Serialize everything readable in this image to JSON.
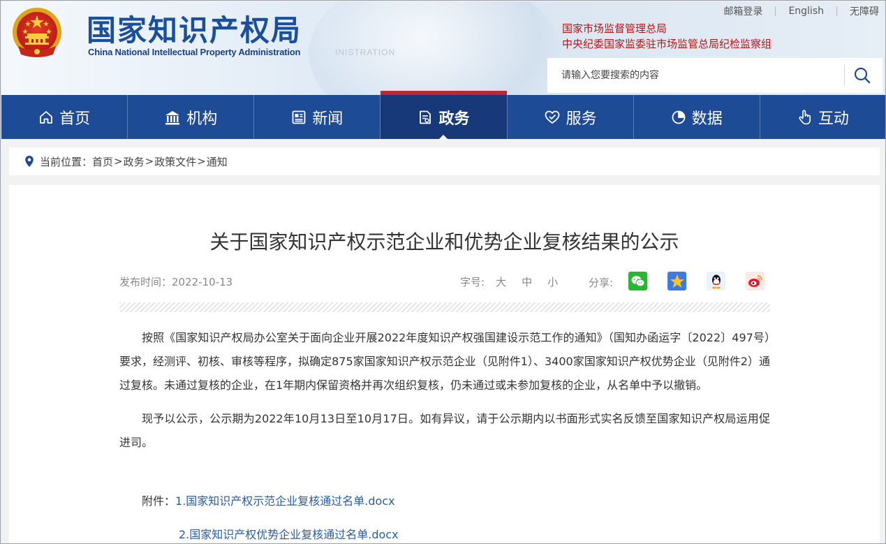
{
  "header": {
    "site_title": "国家知识产权局",
    "site_subtitle": "China National Intellectual Property Administration",
    "top_links": [
      "邮箱登录",
      "English",
      "无障碍"
    ],
    "org_links": [
      "国家市场监督管理总局",
      "中央纪委国家监委驻市场监管总局纪检监察组"
    ],
    "search_placeholder": "请输入您要搜索的内容"
  },
  "nav": {
    "items": [
      {
        "label": "首页",
        "icon": "home-icon"
      },
      {
        "label": "机构",
        "icon": "institution-icon"
      },
      {
        "label": "新闻",
        "icon": "news-icon"
      },
      {
        "label": "政务",
        "icon": "government-affairs-icon",
        "active": true
      },
      {
        "label": "服务",
        "icon": "service-icon"
      },
      {
        "label": "数据",
        "icon": "data-icon"
      },
      {
        "label": "互动",
        "icon": "interaction-icon"
      }
    ]
  },
  "breadcrumb": {
    "prefix": "当前位置：",
    "items": [
      "首页",
      "政务",
      "政策文件",
      "通知"
    ],
    "separator": ">"
  },
  "article": {
    "title": "关于国家知识产权示范企业和优势企业复核结果的公示",
    "publish_label": "发布时间：",
    "publish_date": "2022-10-13",
    "font_size_label": "字号:",
    "font_sizes": [
      "大",
      "中",
      "小"
    ],
    "share_label": "分享:",
    "share_targets": [
      "wechat-icon",
      "qzone-icon",
      "qq-icon",
      "weibo-icon"
    ],
    "paragraphs": [
      "按照《国家知识产权局办公室关于面向企业开展2022年度知识产权强国建设示范工作的通知》（国知办函运字〔2022〕497号）要求，经测评、初核、审核等程序，拟确定875家国家知识产权示范企业（见附件1）、3400家国家知识产权优势企业（见附件2）通过复核。未通过复核的企业，在1年期内保留资格并再次组织复核，仍未通过或未参加复核的企业，从名单中予以撤销。",
      "现予以公示，公示期为2022年10月13日至10月17日。如有异议，请于公示期内以书面形式实名反馈至国家知识产权局运用促进司。"
    ],
    "attachments_label": "附件：",
    "attachments": [
      "1.国家知识产权示范企业复核通过名单.docx",
      "2.国家知识产权优势企业复核通过名单.docx"
    ]
  },
  "colors": {
    "nav_bg": "#1e4b95",
    "nav_active_bg": "#17397a",
    "active_top_bar": "#c0262d",
    "title_blue": "#1b4f9c",
    "org_link_red": "#b01818",
    "attachment_link": "#2a5ba8"
  }
}
